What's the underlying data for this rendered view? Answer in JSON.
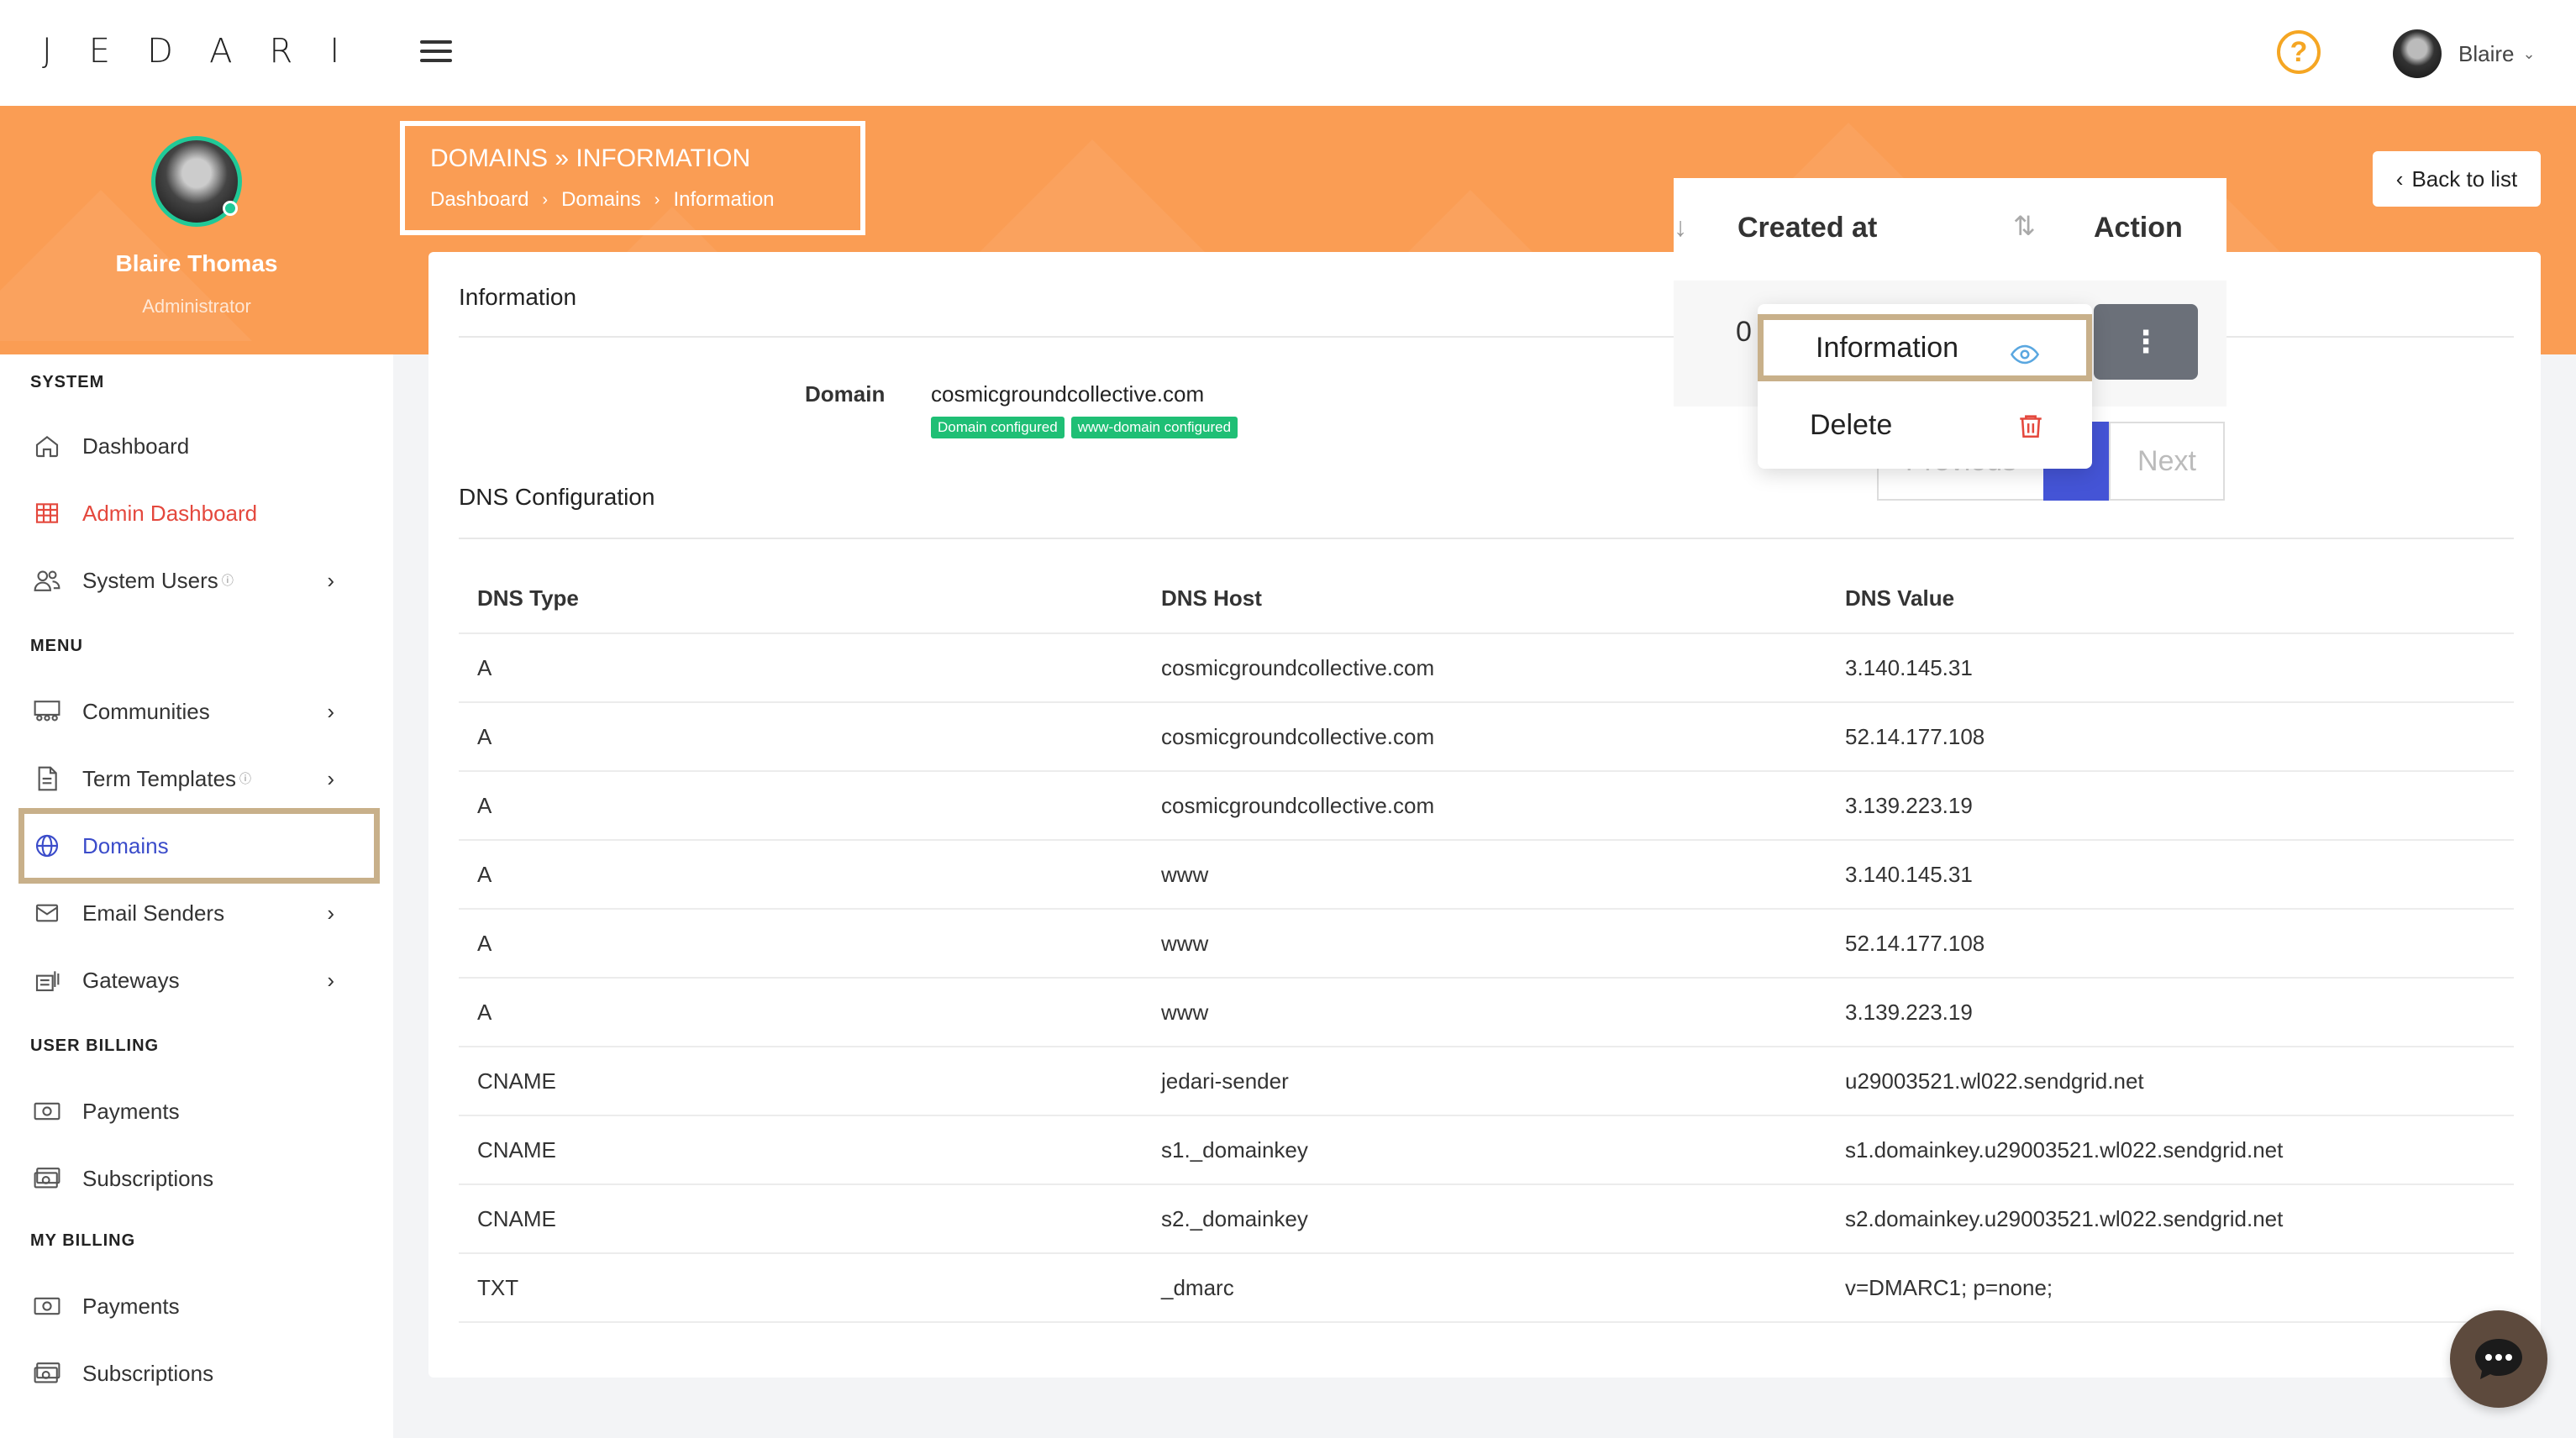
{
  "app": {
    "logo_text": "JEDARI"
  },
  "topbar": {
    "user_name": "Blaire",
    "help_symbol": "?"
  },
  "profile": {
    "name": "Blaire Thomas",
    "role": "Administrator"
  },
  "sidebar": {
    "sections": [
      {
        "title": "SYSTEM"
      },
      {
        "title": "MENU"
      },
      {
        "title": "USER BILLING"
      },
      {
        "title": "MY BILLING"
      }
    ],
    "items": [
      {
        "label": "Dashboard",
        "icon": "home-icon"
      },
      {
        "label": "Admin Dashboard",
        "icon": "grid-icon"
      },
      {
        "label": "System Users",
        "icon": "users-icon"
      },
      {
        "label": "Communities",
        "icon": "communities-icon"
      },
      {
        "label": "Term Templates",
        "icon": "document-icon"
      },
      {
        "label": "Domains",
        "icon": "globe-icon"
      },
      {
        "label": "Email Senders",
        "icon": "mail-icon"
      },
      {
        "label": "Gateways",
        "icon": "gateway-icon"
      },
      {
        "label": "Payments",
        "icon": "cash-icon"
      },
      {
        "label": "Subscriptions",
        "icon": "cash-stack-icon"
      },
      {
        "label": "Payments",
        "icon": "cash-icon"
      },
      {
        "label": "Subscriptions",
        "icon": "cash-stack-icon"
      }
    ]
  },
  "header": {
    "title": "DOMAINS » INFORMATION",
    "breadcrumb": [
      "Dashboard",
      "Domains",
      "Information"
    ],
    "back_label": "Back to list"
  },
  "info": {
    "card_title": "Information",
    "domain_label": "Domain",
    "domain_value": "cosmicgroundcollective.com",
    "badges": [
      "Domain configured",
      "www-domain configured"
    ],
    "dns_title": "DNS Configuration"
  },
  "dns_table": {
    "columns": [
      "DNS Type",
      "DNS Host",
      "DNS Value"
    ],
    "rows": [
      [
        "A",
        "cosmicgroundcollective.com",
        "3.140.145.31"
      ],
      [
        "A",
        "cosmicgroundcollective.com",
        "52.14.177.108"
      ],
      [
        "A",
        "cosmicgroundcollective.com",
        "3.139.223.19"
      ],
      [
        "A",
        "www",
        "3.140.145.31"
      ],
      [
        "A",
        "www",
        "52.14.177.108"
      ],
      [
        "A",
        "www",
        "3.139.223.19"
      ],
      [
        "CNAME",
        "jedari-sender",
        "u29003521.wl022.sendgrid.net"
      ],
      [
        "CNAME",
        "s1._domainkey",
        "s1.domainkey.u29003521.wl022.sendgrid.net"
      ],
      [
        "CNAME",
        "s2._domainkey",
        "s2.domainkey.u29003521.wl022.sendgrid.net"
      ],
      [
        "TXT",
        "_dmarc",
        "v=DMARC1; p=none;"
      ]
    ]
  },
  "overlay": {
    "col_created": "Created at",
    "col_action": "Action",
    "row_partial": "0",
    "menu": {
      "information": "Information",
      "delete": "Delete"
    },
    "pager": {
      "prev": "Previous",
      "next": "Next"
    }
  },
  "colors": {
    "brand": "#fa9d54",
    "active": "#3b4cca",
    "admin": "#e4483d",
    "badge": "#1fbf75"
  }
}
